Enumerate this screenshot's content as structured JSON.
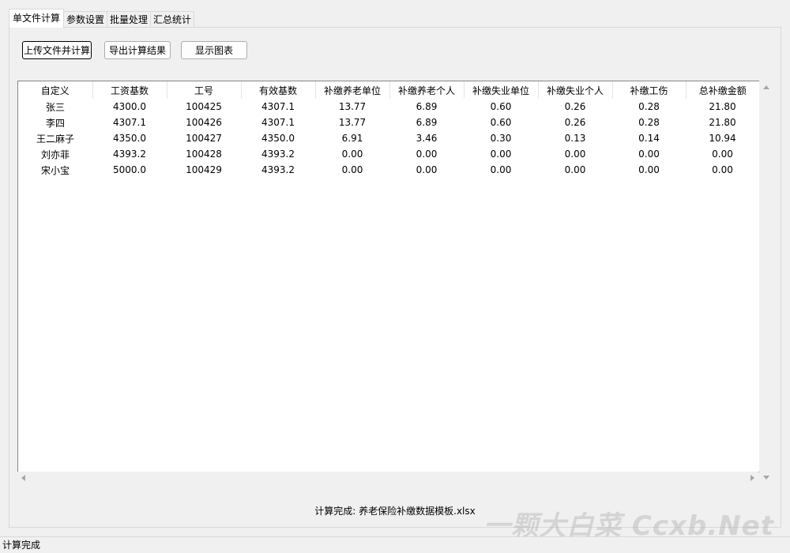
{
  "tabs": [
    {
      "label": "单文件计算",
      "active": true
    },
    {
      "label": "参数设置",
      "active": false
    },
    {
      "label": "批量处理",
      "active": false
    },
    {
      "label": "汇总统计",
      "active": false
    }
  ],
  "toolbar": {
    "upload_label": "上传文件并计算",
    "export_label": "导出计算结果",
    "chart_label": "显示图表"
  },
  "table": {
    "columns": [
      "自定义",
      "工资基数",
      "工号",
      "有效基数",
      "补缴养老单位",
      "补缴养老个人",
      "补缴失业单位",
      "补缴失业个人",
      "补缴工伤",
      "总补缴金额"
    ],
    "rows": [
      [
        "张三",
        "4300.0",
        "100425",
        "4307.1",
        "13.77",
        "6.89",
        "0.60",
        "0.26",
        "0.28",
        "21.80"
      ],
      [
        "李四",
        "4307.1",
        "100426",
        "4307.1",
        "13.77",
        "6.89",
        "0.60",
        "0.26",
        "0.28",
        "21.80"
      ],
      [
        "王二麻子",
        "4350.0",
        "100427",
        "4350.0",
        "6.91",
        "3.46",
        "0.30",
        "0.13",
        "0.14",
        "10.94"
      ],
      [
        "刘亦菲",
        "4393.2",
        "100428",
        "4393.2",
        "0.00",
        "0.00",
        "0.00",
        "0.00",
        "0.00",
        "0.00"
      ],
      [
        "宋小宝",
        "5000.0",
        "100429",
        "4393.2",
        "0.00",
        "0.00",
        "0.00",
        "0.00",
        "0.00",
        "0.00"
      ]
    ]
  },
  "result_message": "计算完成: 养老保险补缴数据模板.xlsx",
  "watermark": "一颗大白菜 Ccxb.Net",
  "statusbar": {
    "text": "计算完成"
  }
}
